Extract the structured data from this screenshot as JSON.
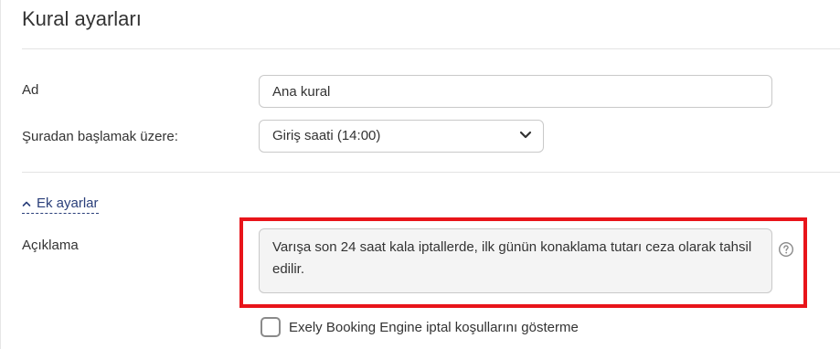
{
  "page": {
    "title": "Kural ayarları"
  },
  "form": {
    "name": {
      "label": "Ad",
      "value": "Ana kural"
    },
    "start_from": {
      "label": "Şuradan başlamak üzere:",
      "selected": "Giriş saati (14:00)"
    },
    "more_settings": {
      "label": "Ek ayarlar"
    },
    "description": {
      "label": "Açıklama",
      "value": "Varışa son 24 saat kala iptallerde, ilk günün konaklama tutarı ceza olarak tahsil edilir."
    },
    "hide_policy": {
      "label": "Exely Booking Engine iptal koşullarını gösterme",
      "checked": false
    }
  },
  "colors": {
    "highlight": "#e8141a",
    "link": "#2a3f7a"
  },
  "icons": {
    "select_arrow": "chevron-down-icon",
    "collapse": "chevron-up-icon",
    "help": "question-circle-icon"
  }
}
